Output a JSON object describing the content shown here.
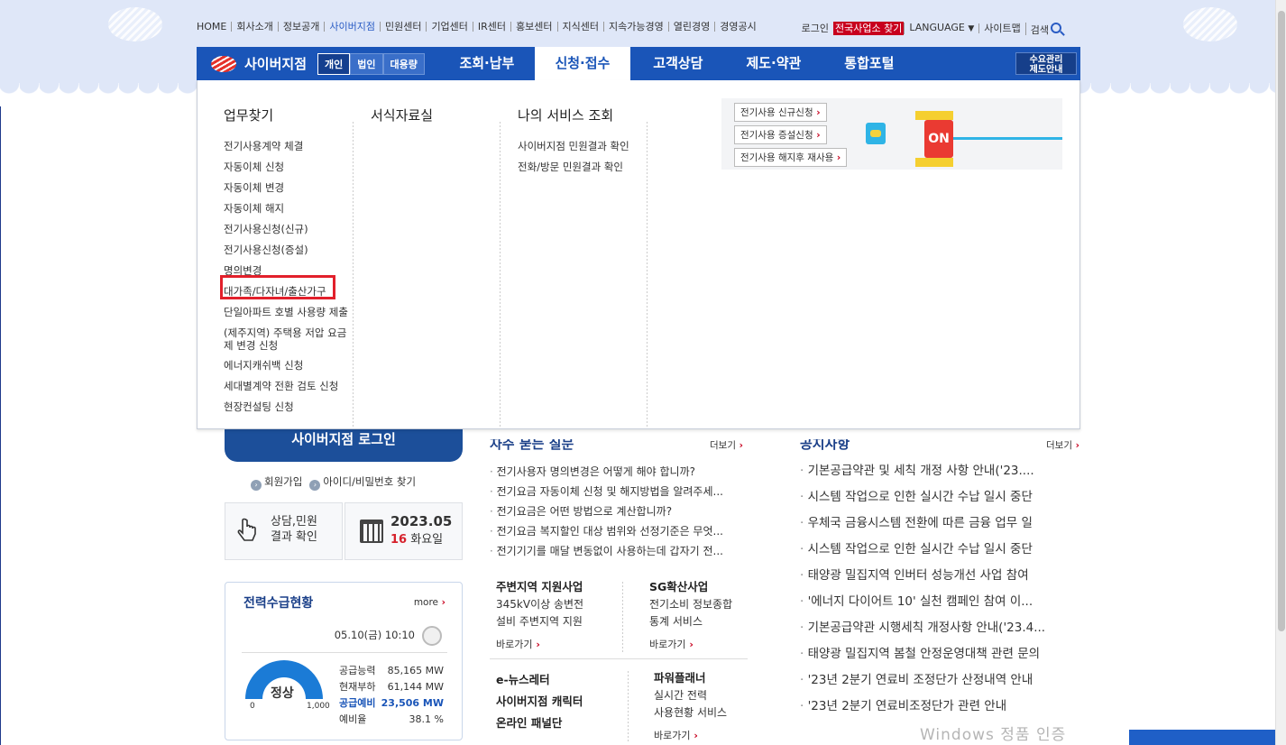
{
  "util": {
    "left": [
      "HOME",
      "회사소개",
      "정보공개",
      "사이버지점",
      "민원센터",
      "기업센터",
      "IR센터",
      "홍보센터",
      "지식센터",
      "지속가능경영",
      "열린경영",
      "경영공시"
    ],
    "login": "로그인",
    "find_office": "전국사업소 찾기",
    "language": "LANGUAGE",
    "sitemap": "사이트맵",
    "search": "검색"
  },
  "gnb": {
    "logo": "사이버지점",
    "segments": [
      "개인",
      "법인",
      "대용량"
    ],
    "menu": [
      "조회·납부",
      "신청·접수",
      "고객상담",
      "제도·약관",
      "통합포털"
    ],
    "demand": [
      "수요관리",
      "제도안내"
    ]
  },
  "dropdown": {
    "col1": {
      "title": "업무찾기",
      "items": [
        "전기사용계약 체결",
        "자동이체 신청",
        "자동이체 변경",
        "자동이체 해지",
        "전기사용신청(신규)",
        "전기사용신청(증설)",
        "명의변경",
        "대가족/다자녀/출산가구",
        "단일아파트 호별 사용량 제출",
        "(제주지역) 주택용 저압 요금",
        "제 변경 신청",
        "에너지캐쉬백 신청",
        "세대별계약 전환 검토 신청",
        "현장컨설팅 신청"
      ]
    },
    "col2": {
      "title": "서식자료실"
    },
    "col3": {
      "title": "나의 서비스 조회",
      "items": [
        "사이버지점 민원결과 확인",
        "전화/방문 민원결과 확인"
      ]
    },
    "promo": {
      "buttons": [
        "전기사용 신규신청",
        "전기사용 증설신청",
        "전기사용 해지후 재사용"
      ],
      "on": "ON"
    }
  },
  "left": {
    "login": "사이버지점 로그인",
    "join": "회원가입",
    "find": "아이디/비밀번호 찾기",
    "consult": [
      "상담,민원",
      "결과 확인"
    ],
    "year_month": "2023.05",
    "day": "16",
    "weekday": "화요일"
  },
  "power": {
    "title": "전력수급현황",
    "more": "more",
    "datetime": "05.10(금) 10:10",
    "status": "정상",
    "scale_min": "0",
    "scale_max": "1,000",
    "stats": [
      {
        "label": "공급능력",
        "value": "85,165 MW"
      },
      {
        "label": "현재부하",
        "value": "61,144 MW"
      },
      {
        "label": "공급예비",
        "value": "23,506 MW"
      },
      {
        "label": "예비율",
        "value": "38.1 %"
      }
    ]
  },
  "faq": {
    "title": "자주 묻는 질문",
    "more": "더보기",
    "items": [
      "전기사용자 명의변경은 어떻게 해야 합니까?",
      "전기요금 자동이체 신청 및 해지방법을 알려주세...",
      "전기요금은 어떤 방법으로 계산합니까?",
      "전기요금 복지할인 대상 범위와 선정기준은 무엇...",
      "전기기기를 매달 변동없이 사용하는데 갑자기 전..."
    ]
  },
  "quick": {
    "a_title": "주변지역 지원사업",
    "a_desc": [
      "345kV이상 송변전",
      "설비 주변지역 지원"
    ],
    "b_title": "SG확산사업",
    "b_desc": [
      "전기소비 정보종합",
      "통계 서비스"
    ],
    "go": "바로가기",
    "c_items": [
      "e-뉴스레터",
      "사이버지점 캐릭터",
      "온라인 패널단"
    ],
    "d_title": "파워플래너",
    "d_desc": [
      "실시간 전력",
      "사용현황 서비스"
    ]
  },
  "notice": {
    "title": "공지사항",
    "more": "더보기",
    "items": [
      "기본공급약관 및 세칙 개정 사항 안내('23....",
      "시스템 작업으로 인한 실시간 수납 일시 중단",
      "우체국 금융시스템 전환에 따른 금융 업무 일",
      "시스템 작업으로 인한 실시간 수납 일시 중단",
      "태양광 밀집지역 인버터 성능개선 사업 참여",
      "'에너지 다이어트 10' 실천 캠페인 참여 이...",
      "기본공급약관 시행세칙 개정사항 안내('23.4...",
      "태양광 밀집지역 봄철 안정운영대책 관련 문의",
      "'23년 2분기 연료비 조정단가 산정내역 안내",
      "'23년 2분기 연료비조정단가 관련 안내"
    ]
  },
  "watermark": "Windows 정품 인증"
}
